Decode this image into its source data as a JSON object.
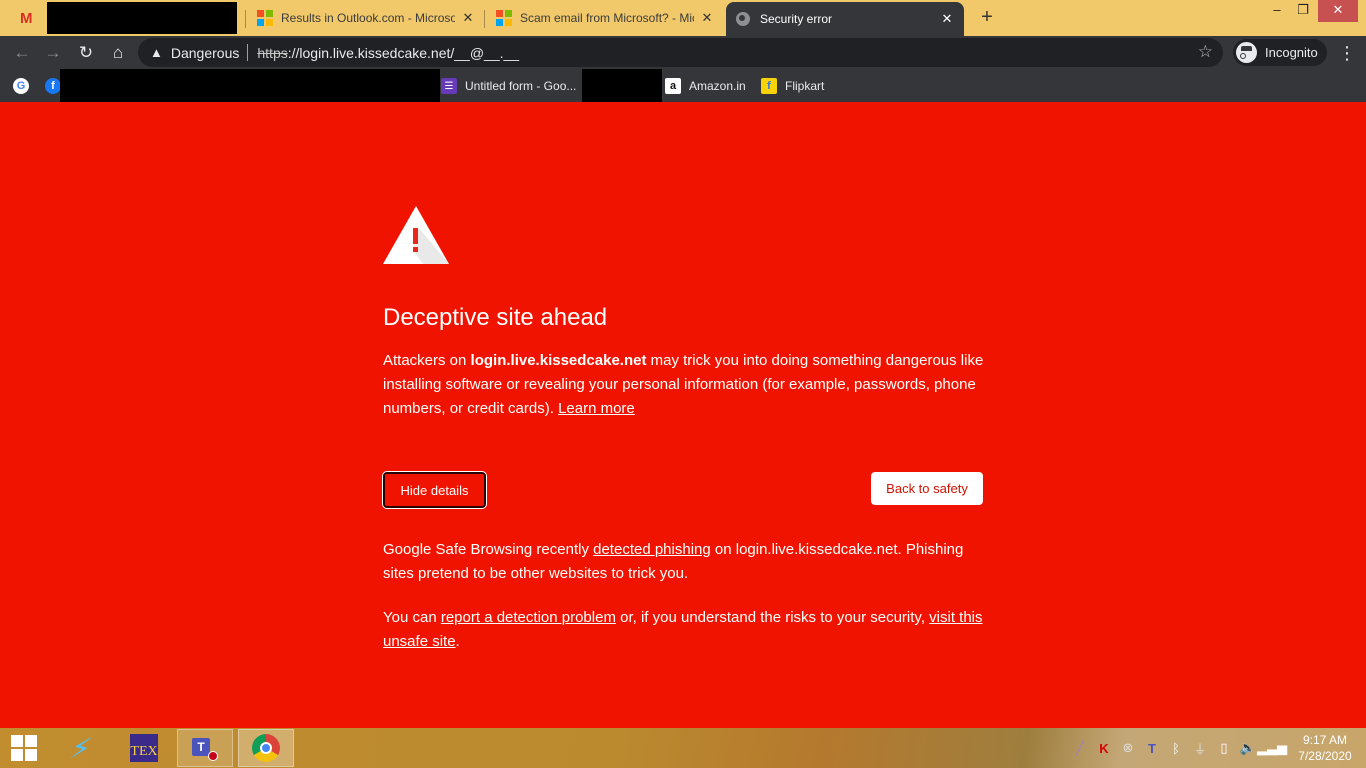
{
  "browser": {
    "tabs": [
      {
        "title": "",
        "icon": "gmail-icon",
        "redacted": true,
        "active": false
      },
      {
        "title": "Results in Outlook.com - Microsoft",
        "icon": "microsoft-icon",
        "active": false
      },
      {
        "title": "Scam email from Microsoft? - Microsoft",
        "icon": "microsoft-icon",
        "active": false
      },
      {
        "title": "Security error",
        "icon": "globe-icon",
        "active": true
      }
    ],
    "new_tab_label": "+",
    "window_controls": {
      "minimize": "–",
      "restore": "❐",
      "close": "✕"
    },
    "toolbar": {
      "back": "←",
      "forward": "→",
      "reload": "↻",
      "home": "⌂",
      "security_label": "Dangerous",
      "url_scheme": "https",
      "url_rest": "://login.live.kissedcake.net/__@__.__",
      "star": "☆",
      "profile_label": "Incognito",
      "menu": "⋮"
    },
    "bookmarks": [
      {
        "label": "",
        "icon": "google-icon"
      },
      {
        "label": "",
        "icon": "facebook-icon"
      },
      {
        "label": "Untitled form - Goo...",
        "icon": "google-forms-icon"
      },
      {
        "label": "Amazon.in",
        "icon": "amazon-icon"
      },
      {
        "label": "Flipkart",
        "icon": "flipkart-icon"
      }
    ]
  },
  "interstitial": {
    "title": "Deceptive site ahead",
    "intro_prefix": "Attackers on ",
    "intro_domain": "login.live.kissedcake.net",
    "intro_suffix": " may trick you into doing something dangerous like installing software or revealing your personal information (for example, passwords, phone numbers, or credit cards). ",
    "learn_more": "Learn more",
    "hide_details_label": "Hide details",
    "back_to_safety_label": "Back to safety",
    "details_1_prefix": "Google Safe Browsing recently ",
    "details_1_link": "detected phishing",
    "details_1_suffix": " on login.live.kissedcake.net. Phishing sites pretend to be other websites to trick you.",
    "details_2_prefix": "You can ",
    "details_2_link1": "report a detection problem",
    "details_2_middle": " or, if you understand the risks to your security, ",
    "details_2_link2": "visit this unsafe site",
    "details_2_suffix": ".",
    "colors": {
      "background": "#f01400",
      "text": "#ffffff",
      "button_text": "#d01000"
    }
  },
  "taskbar": {
    "apps": [
      "start",
      "lightning-app",
      "texmaker",
      "microsoft-teams",
      "google-chrome"
    ],
    "tray_icons": [
      "pen",
      "kaspersky",
      "network-error",
      "teams",
      "bluetooth",
      "usb-safe-remove",
      "battery",
      "volume",
      "signal"
    ],
    "time": "9:17 AM",
    "date": "7/28/2020"
  }
}
